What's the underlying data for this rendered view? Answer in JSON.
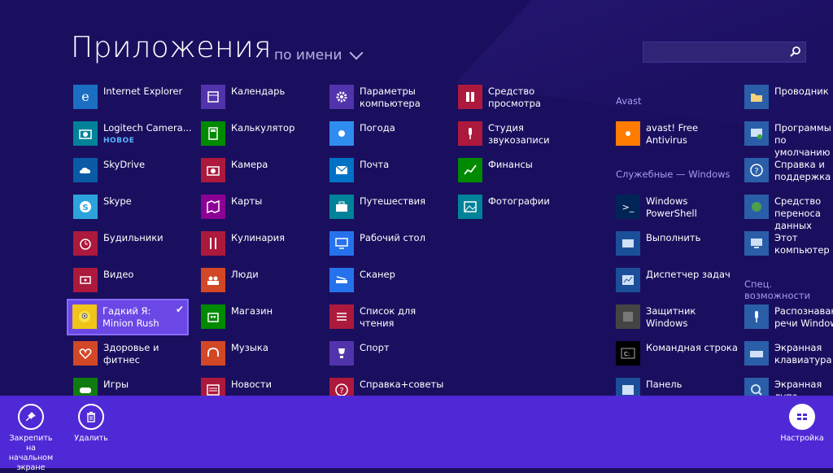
{
  "header": {
    "title": "Приложения",
    "sort_label": "по имени",
    "search_placeholder": ""
  },
  "columns": [
    {
      "items": [
        {
          "label": "Internet Explorer",
          "color": "#1b6ec2",
          "icon": "ie-icon"
        },
        {
          "label": "Logitech Camera...",
          "color": "#008299",
          "icon": "camera-icon",
          "badge": "НОВОЕ"
        },
        {
          "label": "SkyDrive",
          "color": "#0b5aa6",
          "icon": "cloud-icon"
        },
        {
          "label": "Skype",
          "color": "#2da3dc",
          "icon": "skype-icon"
        },
        {
          "label": "Будильники",
          "color": "#ac193d",
          "icon": "alarm-icon"
        },
        {
          "label": "Видео",
          "color": "#ac193d",
          "icon": "video-icon"
        },
        {
          "label": "Гадкий Я: Minion Rush",
          "color": "#f0c419",
          "icon": "minion-icon",
          "selected": true
        },
        {
          "label": "Здоровье и фитнес",
          "color": "#d24726",
          "icon": "heart-icon"
        },
        {
          "label": "Игры",
          "color": "#107c10",
          "icon": "gamepad-icon"
        }
      ]
    },
    {
      "items": [
        {
          "label": "Календарь",
          "color": "#5133ab",
          "icon": "calendar-icon"
        },
        {
          "label": "Калькулятор",
          "color": "#008a00",
          "icon": "calculator-icon"
        },
        {
          "label": "Камера",
          "color": "#ac193d",
          "icon": "camera-icon"
        },
        {
          "label": "Карты",
          "color": "#8c0095",
          "icon": "map-icon"
        },
        {
          "label": "Кулинария",
          "color": "#ac193d",
          "icon": "utensils-icon"
        },
        {
          "label": "Люди",
          "color": "#d24726",
          "icon": "people-icon"
        },
        {
          "label": "Магазин",
          "color": "#008a00",
          "icon": "store-icon"
        },
        {
          "label": "Музыка",
          "color": "#d24726",
          "icon": "headphones-icon"
        },
        {
          "label": "Новости",
          "color": "#ac193d",
          "icon": "news-icon"
        }
      ]
    },
    {
      "items": [
        {
          "label": "Параметры компьютера",
          "color": "#5133ab",
          "icon": "gear-icon"
        },
        {
          "label": "Погода",
          "color": "#2e8def",
          "icon": "sun-icon"
        },
        {
          "label": "Почта",
          "color": "#0072c6",
          "icon": "mail-icon"
        },
        {
          "label": "Путешествия",
          "color": "#008299",
          "icon": "suitcase-icon"
        },
        {
          "label": "Рабочий стол",
          "color": "#2672ec",
          "icon": "desktop-icon"
        },
        {
          "label": "Сканер",
          "color": "#2672ec",
          "icon": "scanner-icon"
        },
        {
          "label": "Список для чтения",
          "color": "#ac193d",
          "icon": "reading-list-icon"
        },
        {
          "label": "Спорт",
          "color": "#5133ab",
          "icon": "trophy-icon"
        },
        {
          "label": "Справка+советы",
          "color": "#ac193d",
          "icon": "help-icon"
        }
      ]
    },
    {
      "items": [
        {
          "label": "Средство просмотра",
          "color": "#ac193d",
          "icon": "reader-icon"
        },
        {
          "label": "Студия звукозаписи",
          "color": "#ac193d",
          "icon": "microphone-icon"
        },
        {
          "label": "Финансы",
          "color": "#008a00",
          "icon": "chart-icon"
        },
        {
          "label": "Фотографии",
          "color": "#008299",
          "icon": "photo-icon"
        }
      ]
    }
  ],
  "groups": {
    "avast": "Avast",
    "service": "Служебные — Windows",
    "access": "Спец. возможности"
  },
  "col5": [
    {
      "label": "avast! Free Antivirus",
      "color": "#ff7c00",
      "icon": "avast-icon"
    },
    {
      "label": "Windows PowerShell",
      "color": "#012456",
      "icon": "powershell-icon"
    },
    {
      "label": "Выполнить",
      "color": "#1b4f9a",
      "icon": "run-icon"
    },
    {
      "label": "Диспетчер задач",
      "color": "#1b4f9a",
      "icon": "task-manager-icon"
    },
    {
      "label": "Защитник Windows",
      "color": "#444",
      "icon": "defender-icon"
    },
    {
      "label": "Командная строка",
      "color": "#000",
      "icon": "cmd-icon"
    },
    {
      "label": "Панель",
      "color": "#1b4f9a",
      "icon": "control-panel-icon"
    }
  ],
  "col6": [
    {
      "label": "Проводник",
      "color": "#2a5ea8",
      "icon": "folder-icon"
    },
    {
      "label": "Программы по умолчанию",
      "color": "#2a5ea8",
      "icon": "default-programs-icon"
    },
    {
      "label": "Справка и поддержка",
      "color": "#2a5ea8",
      "icon": "help-icon"
    },
    {
      "label": "Средство переноса данных",
      "color": "#2a5ea8",
      "icon": "transfer-icon"
    },
    {
      "label": "Этот компьютер",
      "color": "#2a5ea8",
      "icon": "computer-icon"
    },
    {
      "label": "Распознавание речи Windows",
      "color": "#2a5ea8",
      "icon": "microphone-icon"
    },
    {
      "label": "Экранная клавиатура",
      "color": "#2a5ea8",
      "icon": "keyboard-icon"
    },
    {
      "label": "Экранная лупа",
      "color": "#2a5ea8",
      "icon": "magnifier-icon"
    }
  ],
  "appbar": {
    "pin_label": "Закрепить на начальном экране",
    "delete_label": "Удалить",
    "settings_label": "Настройка"
  }
}
